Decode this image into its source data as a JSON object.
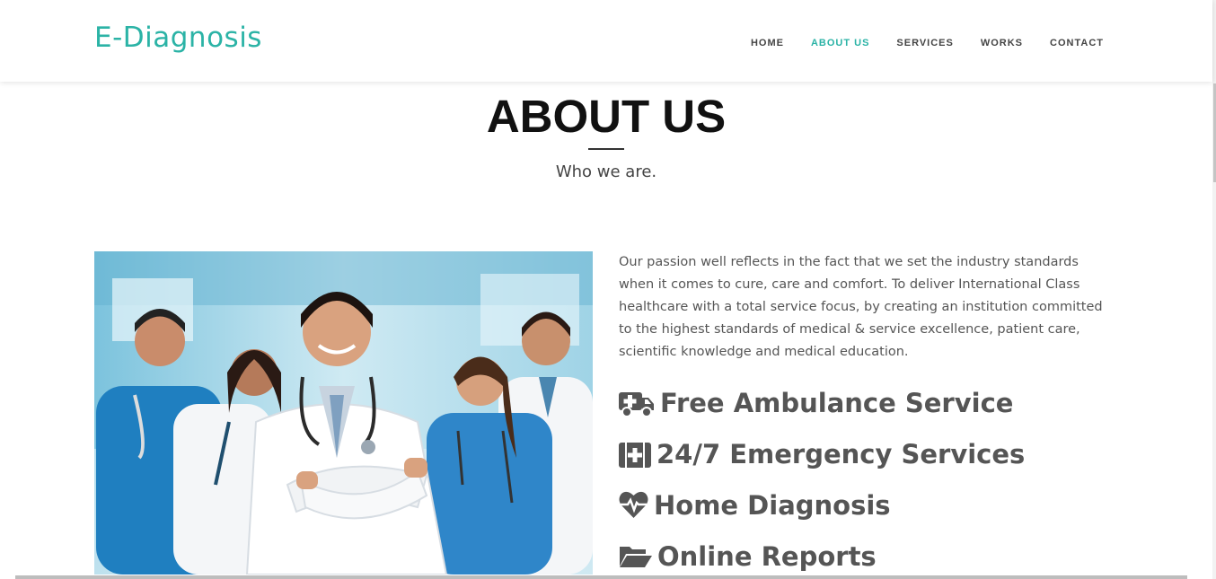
{
  "brand": {
    "name": "E-Diagnosis",
    "color": "#2bb3a6"
  },
  "nav": {
    "items": [
      {
        "label": "HOME",
        "active": false
      },
      {
        "label": "ABOUT US",
        "active": true
      },
      {
        "label": "SERVICES",
        "active": false
      },
      {
        "label": "WORKS",
        "active": false
      },
      {
        "label": "CONTACT",
        "active": false
      }
    ]
  },
  "section": {
    "title": "ABOUT US",
    "subtitle": "Who we are."
  },
  "about": {
    "paragraph": "Our passion well reflects in the fact that we set the industry standards when it comes to cure, care and comfort. To deliver International Class healthcare with a total service focus, by creating an institution committed to the highest standards of medical & service excellence, patient care, scientific knowledge and medical education.",
    "features": [
      {
        "icon": "ambulance-icon",
        "label": "Free Ambulance Service"
      },
      {
        "icon": "medkit-icon",
        "label": "24/7 Emergency Services"
      },
      {
        "icon": "heartbeat-icon",
        "label": "Home Diagnosis"
      },
      {
        "icon": "folder-open-icon",
        "label": "Online Reports"
      }
    ]
  },
  "colors": {
    "accent": "#2bb3a6",
    "text": "#555555",
    "heading": "#111111"
  }
}
